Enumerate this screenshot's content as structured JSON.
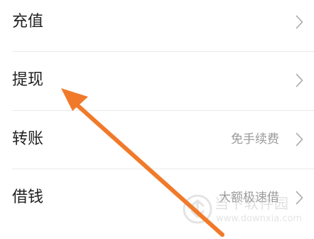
{
  "menu": {
    "items": [
      {
        "label": "充值",
        "note": ""
      },
      {
        "label": "提现",
        "note": ""
      },
      {
        "label": "转账",
        "note": "免手续费"
      },
      {
        "label": "借钱",
        "note": "大额极速借"
      }
    ]
  },
  "overlay": {
    "arrow_color": "#f07a2a"
  },
  "watermark": {
    "name": "当下软件园",
    "url": "www.downxia.com"
  }
}
